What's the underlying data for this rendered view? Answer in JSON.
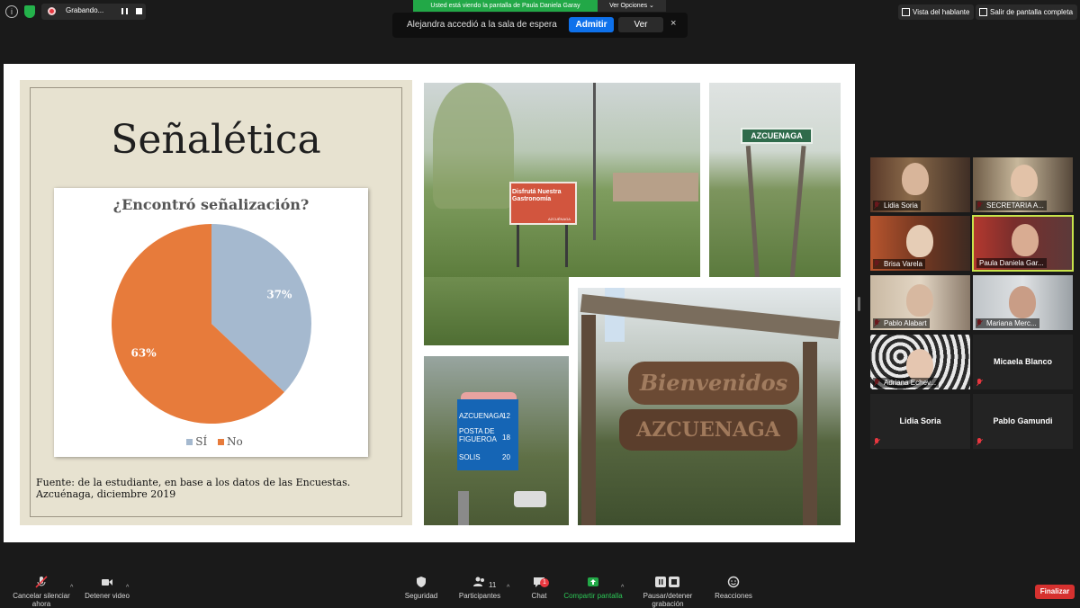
{
  "top_bar": {
    "recording_label": "Grabando...",
    "viewing_banner": "Usted está viendo la pantalla de Paula Daniela Garay",
    "view_options": "Ver Opciones",
    "speaker_view": "Vista del hablante",
    "exit_fullscreen": "Salir de pantalla completa"
  },
  "waiting_room": {
    "message": "Alejandra accedió a la sala de espera",
    "admit_label": "Admitir",
    "see_label": "Ver",
    "close_glyph": "×"
  },
  "slide": {
    "title": "Señalética",
    "source": "Fuente: de la estudiante, en base a los datos de las Encuestas. Azcuénaga, diciembre 2019",
    "signs": {
      "red_sign_text": "Disfrutá Nuestra Gastronomía",
      "red_sign_sub": "AZCUÉNAGA",
      "green_sign": "AZCUENAGA",
      "blue_sign_rows": [
        {
          "place": "AZCUENAGA",
          "km": "12"
        },
        {
          "place": "POSTA DE FIGUEROA",
          "km": "18"
        },
        {
          "place": "SOLIS",
          "km": "20"
        }
      ],
      "welcome": "Bienvenidos",
      "town": "AZCUENAGA"
    }
  },
  "chart_data": {
    "type": "pie",
    "title": "¿Encontró señalización?",
    "categories": [
      "SÍ",
      "No"
    ],
    "values": [
      37,
      63
    ],
    "labels": [
      "37%",
      "63%"
    ],
    "colors": [
      "#a5b9cf",
      "#e77b3b"
    ],
    "legend_position": "bottom"
  },
  "participants": [
    {
      "name": "Lidia Soria",
      "muted": true,
      "video": true,
      "active": false
    },
    {
      "name": "SECRETARIA A...",
      "muted": true,
      "video": true,
      "active": false
    },
    {
      "name": "Brisa Varela",
      "muted": true,
      "video": true,
      "active": false
    },
    {
      "name": "Paula Daniela Gar...",
      "muted": false,
      "video": true,
      "active": true
    },
    {
      "name": "Pablo Alabart",
      "muted": true,
      "video": true,
      "active": false
    },
    {
      "name": "Mariana Merc...",
      "muted": true,
      "video": true,
      "active": false
    },
    {
      "name": "Adriana Echev...",
      "muted": true,
      "video": true,
      "active": false
    },
    {
      "name": "Micaela Blanco",
      "muted": true,
      "video": false,
      "active": false
    },
    {
      "name": "Lidia Soria",
      "muted": true,
      "video": false,
      "active": false
    },
    {
      "name": "Pablo Gamundi",
      "muted": true,
      "video": false,
      "active": false
    }
  ],
  "toolbar": {
    "unmute_label": "Cancelar silenciar ahora",
    "stop_video_label": "Detener video",
    "security_label": "Seguridad",
    "participants_label": "Participantes",
    "participants_count": "11",
    "chat_label": "Chat",
    "chat_badge": "1",
    "share_label": "Compartir pantalla",
    "pause_recording_label": "Pausar/detener grabación",
    "reactions_label": "Reacciones",
    "end_label": "Finalizar"
  },
  "colors": {
    "zoom_blue": "#0e71eb",
    "share_green": "#22a847",
    "end_red": "#d6312f",
    "active_speaker": "#c7e34b"
  }
}
